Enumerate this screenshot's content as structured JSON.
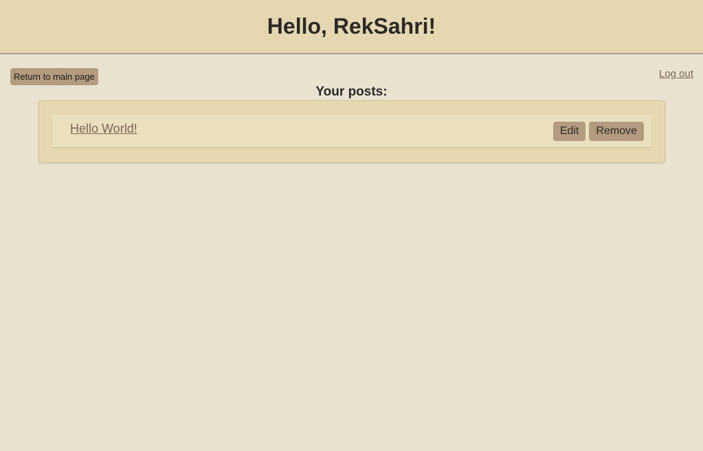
{
  "header": {
    "greeting": "Hello, RekSahri!"
  },
  "nav": {
    "return_label": "Return to main page",
    "logout_label": "Log out"
  },
  "posts_section": {
    "title": "Your posts:",
    "posts": [
      {
        "title": "Hello World!",
        "edit_label": "Edit",
        "remove_label": "Remove"
      }
    ]
  },
  "colors": {
    "page_background": "#e9e2d1",
    "header_background": "#e5d8b0",
    "button_background": "#b39b80",
    "link_color": "#7a6652"
  }
}
